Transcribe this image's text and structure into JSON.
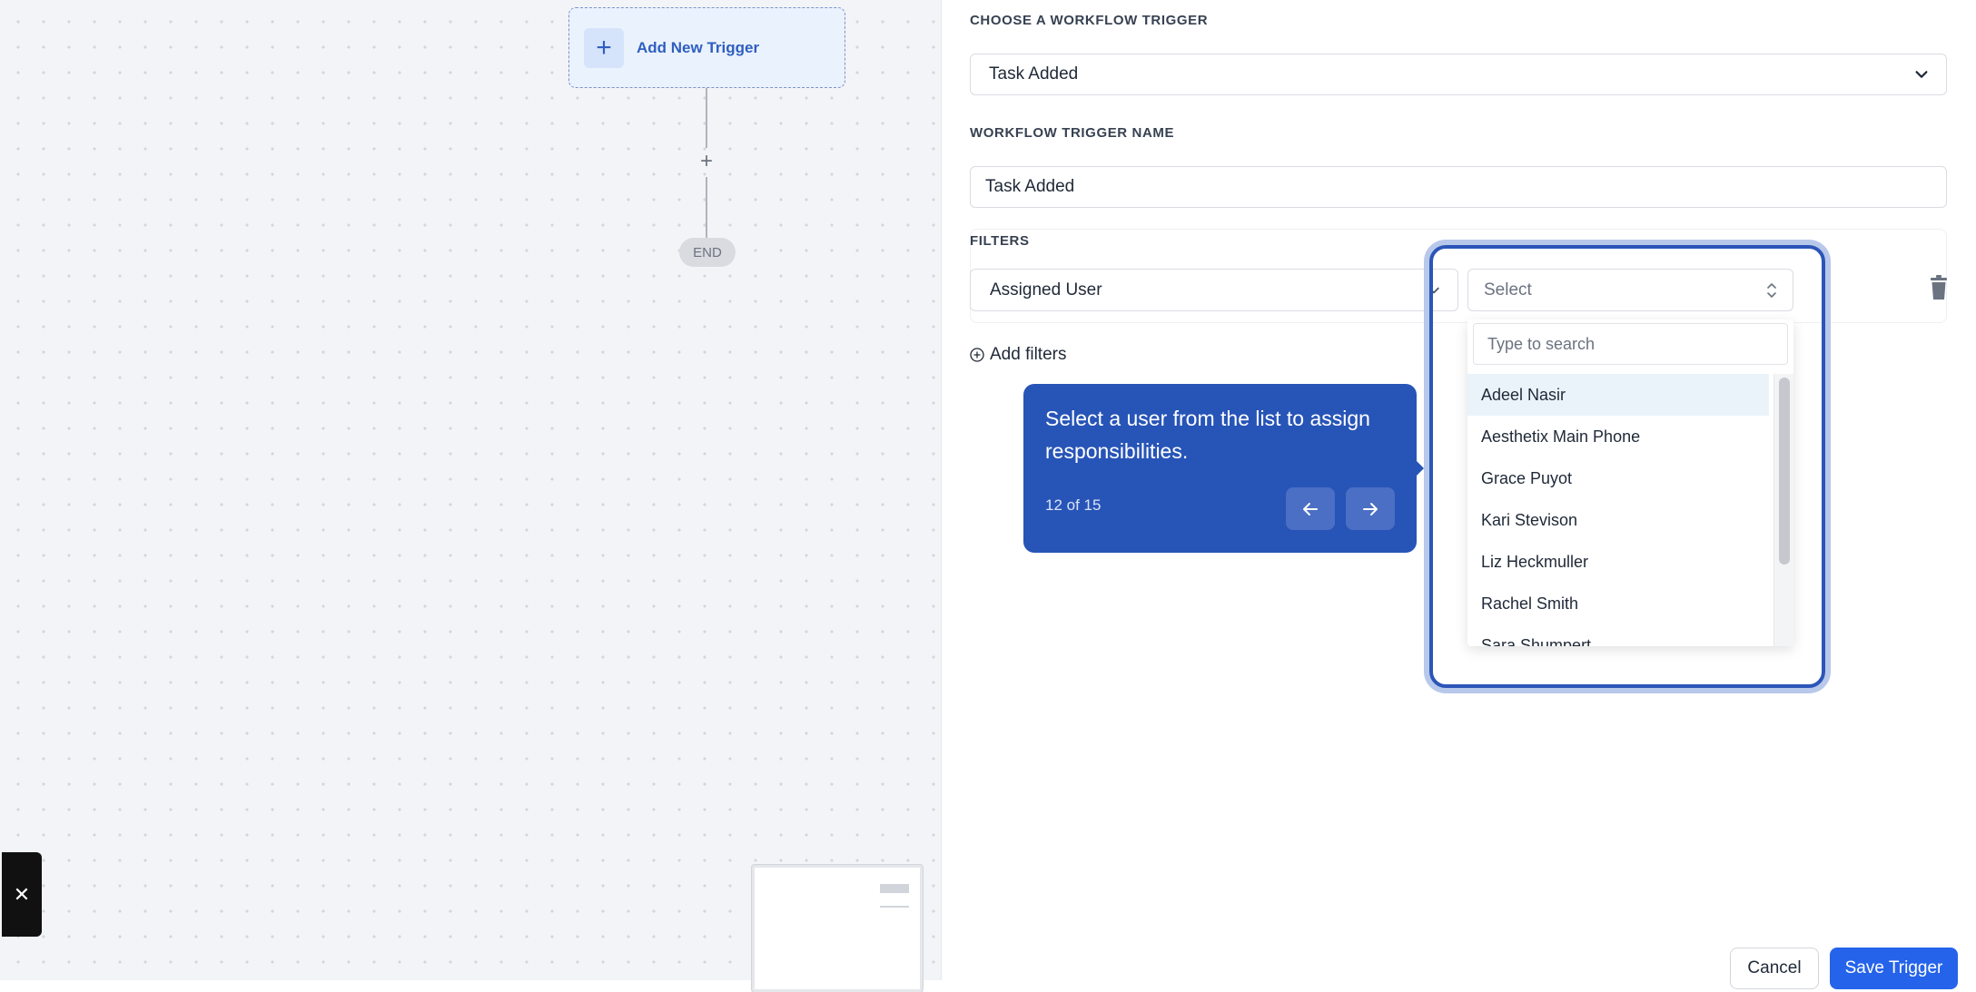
{
  "canvas": {
    "trigger_node": {
      "label": "Add New Trigger",
      "plus": "+"
    },
    "connector_plus": "+",
    "end_label": "END",
    "close_glyph": "✕"
  },
  "panel": {
    "workflow_trigger": {
      "label": "CHOOSE A WORKFLOW TRIGGER",
      "value": "Task Added"
    },
    "trigger_name": {
      "label": "WORKFLOW TRIGGER NAME",
      "value": "Task Added"
    },
    "filters": {
      "label": "FILTERS",
      "field": "Assigned User",
      "value_placeholder": "Select",
      "add_filters": "Add filters"
    },
    "dropdown": {
      "search_placeholder": "Type to search",
      "options": [
        "Adeel Nasir",
        "Aesthetix Main Phone",
        "Grace Puyot",
        "Kari Stevison",
        "Liz Heckmuller",
        "Rachel Smith",
        "Sara Shumpert"
      ],
      "highlighted_index": 0
    },
    "footer": {
      "cancel": "Cancel",
      "save": "Save Trigger"
    }
  },
  "tooltip": {
    "text": "Select a user from the list to assign responsibilities.",
    "counter": "12 of 15"
  },
  "colors": {
    "accent": "#2754b7",
    "primary_button": "#2563eb",
    "trigger_node_bg": "#eaf2fd"
  },
  "icons": [
    "plus-icon",
    "chevron-down-icon",
    "up-down-chevron-icon",
    "trash-icon",
    "add-circle-icon",
    "arrow-left-icon",
    "arrow-right-icon",
    "close-icon"
  ]
}
